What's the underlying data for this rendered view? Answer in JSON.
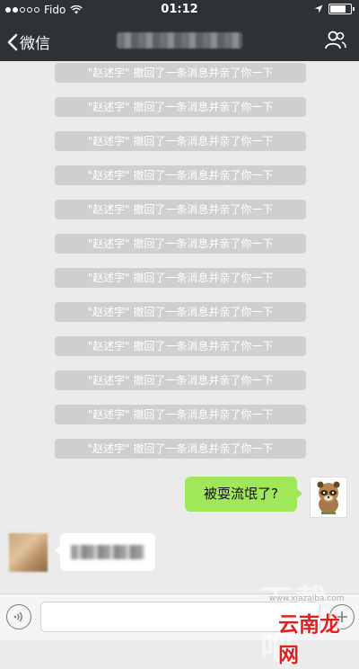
{
  "status_bar": {
    "carrier": "Fido",
    "time": "01:12"
  },
  "nav": {
    "back_label": "微信",
    "title": ""
  },
  "chat": {
    "notices": [
      "\"赵述宇\" 撤回了一条消息并亲了你一下",
      "\"赵述宇\" 撤回了一条消息并亲了你一下",
      "\"赵述宇\" 撤回了一条消息并亲了你一下",
      "\"赵述宇\" 撤回了一条消息并亲了你一下",
      "\"赵述宇\" 撤回了一条消息并亲了你一下",
      "\"赵述宇\" 撤回了一条消息并亲了你一下",
      "\"赵述宇\" 撤回了一条消息并亲了你一下",
      "\"赵述宇\" 撤回了一条消息并亲了你一下",
      "\"赵述宇\" 撤回了一条消息并亲了你一下",
      "\"赵述宇\" 撤回了一条消息并亲了你一下",
      "\"赵述宇\" 撤回了一条消息并亲了你一下",
      "\"赵述宇\" 撤回了一条消息并亲了你一下"
    ],
    "outgoing_message": "被耍流氓了?"
  },
  "input_bar": {
    "placeholder": ""
  },
  "watermark": {
    "large": "下载吧",
    "url": "www.xiazaiba.com",
    "brand": "云南龙网"
  },
  "colors": {
    "nav_bg": "#2e3135",
    "chat_bg": "#ebebeb",
    "notice_bg": "#cfcfcf",
    "outgoing_bubble": "#a0e75a",
    "incoming_bubble": "#ffffff",
    "brand_red": "#e02020"
  },
  "icons": {
    "back": "chevron-left-icon",
    "chat_info": "people-icon",
    "voice": "voice-icon",
    "plus": "plus-icon",
    "wifi": "wifi-icon",
    "location": "location-arrow-icon",
    "battery": "battery-icon"
  },
  "battery_level": 0.85
}
